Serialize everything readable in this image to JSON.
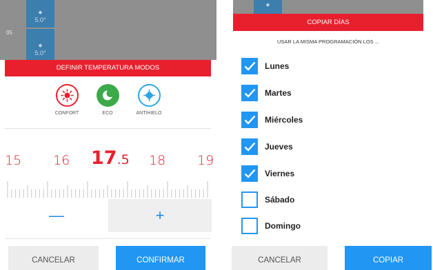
{
  "schedule": {
    "hour_label": "05",
    "entries": [
      {
        "icon": "snowflake-icon",
        "value": "5.0°"
      },
      {
        "icon": "snowflake-icon",
        "value": "5.0°"
      }
    ]
  },
  "left_panel": {
    "header": "DEFINIR TEMPERATURA MODOS",
    "modes": [
      {
        "label": "CONFORT",
        "icon": "sun-icon",
        "color": "#e8202e"
      },
      {
        "label": "ECO",
        "icon": "moon-icon",
        "color": "#3caa4a"
      },
      {
        "label": "ANTIHIELO",
        "icon": "snowflake-icon",
        "color": "#2ba6e3"
      }
    ],
    "temperature_scale": [
      "15",
      "16",
      "18",
      "19"
    ],
    "current_temperature": {
      "integer": "17",
      "decimal": ".5"
    },
    "minus_label": "—",
    "plus_label": "+",
    "cancel_label": "CANCELAR",
    "confirm_label": "CONFIRMAR"
  },
  "right_panel": {
    "schedule_icon": "snowflake-icon",
    "header": "COPIAR DÍAS",
    "subtitle": "USAR LA MISMA PROGRAMACIÓN LOS ...",
    "days": [
      {
        "label": "Lunes",
        "checked": true
      },
      {
        "label": "Martes",
        "checked": true
      },
      {
        "label": "Miércoles",
        "checked": true
      },
      {
        "label": "Jueves",
        "checked": true
      },
      {
        "label": "Viernes",
        "checked": true
      },
      {
        "label": "Sábado",
        "checked": false
      },
      {
        "label": "Domingo",
        "checked": false
      }
    ],
    "cancel_label": "CANCELAR",
    "copy_label": "COPIAR"
  },
  "colors": {
    "accent_red": "#e8202e",
    "accent_blue": "#2196f3",
    "eco_green": "#3caa4a",
    "schedule_blue": "#3c7fae"
  }
}
